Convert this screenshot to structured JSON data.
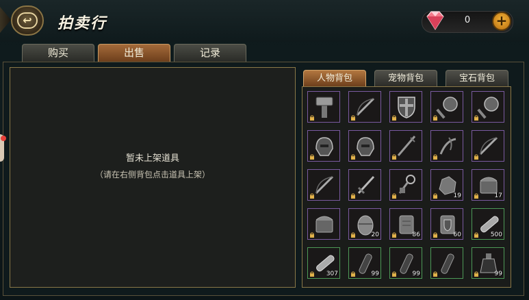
{
  "header": {
    "title": "拍卖行",
    "gem_count": "0"
  },
  "tabs": [
    "购买",
    "出售",
    "记录"
  ],
  "active_tab": 1,
  "sell_panel": {
    "empty_title": "暂未上架道具",
    "empty_hint": "（请在右侧背包点击道具上架）"
  },
  "bag_tabs": [
    "人物背包",
    "宠物背包",
    "宝石背包"
  ],
  "active_bag_tab": 0,
  "slots": [
    {
      "icon": "hammer-icon",
      "count": "",
      "rarity": "purple"
    },
    {
      "icon": "bow-icon",
      "count": "",
      "rarity": "purple"
    },
    {
      "icon": "shield-icon",
      "count": "",
      "rarity": "purple"
    },
    {
      "icon": "round-mace-icon",
      "count": "",
      "rarity": "purple"
    },
    {
      "icon": "round-mace-icon",
      "count": "",
      "rarity": "purple"
    },
    {
      "icon": "helmet-icon",
      "count": "",
      "rarity": "purple"
    },
    {
      "icon": "helmet-icon",
      "count": "",
      "rarity": "purple"
    },
    {
      "icon": "staff-icon",
      "count": "",
      "rarity": "purple"
    },
    {
      "icon": "claw-icon",
      "count": "",
      "rarity": "purple"
    },
    {
      "icon": "bow-icon",
      "count": "",
      "rarity": "purple"
    },
    {
      "icon": "bow-icon",
      "count": "",
      "rarity": "purple"
    },
    {
      "icon": "sword-icon",
      "count": "",
      "rarity": "purple"
    },
    {
      "icon": "key-icon",
      "count": "",
      "rarity": "purple"
    },
    {
      "icon": "ore-icon",
      "count": "19",
      "rarity": "purple"
    },
    {
      "icon": "chest-icon",
      "count": "17",
      "rarity": "purple"
    },
    {
      "icon": "chest-icon",
      "count": "",
      "rarity": "purple"
    },
    {
      "icon": "egg-icon",
      "count": "20",
      "rarity": "purple"
    },
    {
      "icon": "scroll-icon",
      "count": "86",
      "rarity": "purple"
    },
    {
      "icon": "shield-scroll-icon",
      "count": "60",
      "rarity": "purple"
    },
    {
      "icon": "bandage-icon",
      "count": "500",
      "rarity": "green"
    },
    {
      "icon": "bandage-icon",
      "count": "307",
      "rarity": "green"
    },
    {
      "icon": "vial-icon",
      "count": "99",
      "rarity": "green"
    },
    {
      "icon": "vial-icon",
      "count": "99",
      "rarity": "green"
    },
    {
      "icon": "vial-icon",
      "count": "",
      "rarity": "green"
    },
    {
      "icon": "potion-icon",
      "count": "99",
      "rarity": "green"
    }
  ]
}
